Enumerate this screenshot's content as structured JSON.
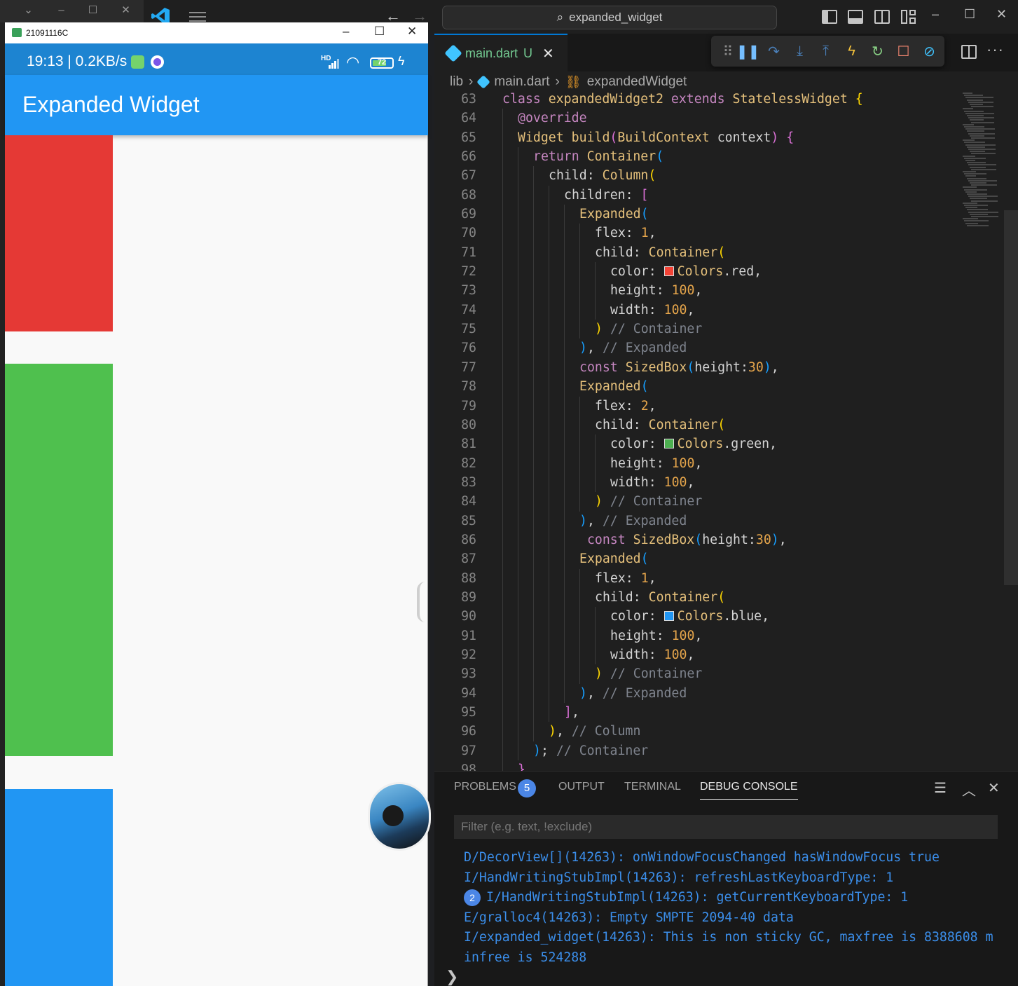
{
  "phone": {
    "window_title": "21091116C",
    "status": {
      "time": "19:13 | 0.2KB/s",
      "network": "HD",
      "battery": "72"
    },
    "app_title": "Expanded Widget",
    "boxes": [
      {
        "name": "red-box",
        "color": "#e53935"
      },
      {
        "name": "green-box",
        "color": "#4fc04e"
      },
      {
        "name": "blue-box",
        "color": "#2196f3"
      }
    ]
  },
  "vscode": {
    "command_center": "expanded_widget",
    "tab": {
      "name": "main.dart",
      "badge": "U"
    },
    "breadcrumb": {
      "root": "lib",
      "file": "main.dart",
      "symbol": "expandedWidget"
    },
    "code_lines": [
      {
        "n": "63",
        "html": "<span class=\"kw\">class</span> <span class=\"ty\">expandedWidget2</span> <span class=\"kw\">extends</span> <span class=\"ty\">StatelessWidget</span> <span class=\"br1\">{</span>",
        "indent": 0
      },
      {
        "n": "64",
        "html": "<span class=\"ann\">@override</span>",
        "indent": 1
      },
      {
        "n": "65",
        "html": "<span class=\"ty\">Widget</span> <span class=\"fn\">build</span><span class=\"br2\">(</span><span class=\"ty\">BuildContext</span> context<span class=\"br2\">)</span> <span class=\"br2\">{</span>",
        "indent": 1
      },
      {
        "n": "66",
        "html": "<span class=\"kw\">return</span> <span class=\"ty\">Container</span><span class=\"br3\">(</span>",
        "indent": 2
      },
      {
        "n": "67",
        "html": "child: <span class=\"ty\">Column</span><span class=\"br1\">(</span>",
        "indent": 3
      },
      {
        "n": "68",
        "html": "children: <span class=\"br2\">[</span>",
        "indent": 4
      },
      {
        "n": "69",
        "html": "<span class=\"ty\">Expanded</span><span class=\"br3\">(</span>",
        "indent": 5
      },
      {
        "n": "70",
        "html": "flex: <span class=\"num\">1</span>,",
        "indent": 6
      },
      {
        "n": "71",
        "html": "child: <span class=\"ty\">Container</span><span class=\"br1\">(</span>",
        "indent": 6
      },
      {
        "n": "72",
        "html": "color: <span class=\"sw\" style=\"background:#f44336\"></span><span class=\"ty\">Colors</span>.red,",
        "indent": 7
      },
      {
        "n": "73",
        "html": "height: <span class=\"num\">100</span>,",
        "indent": 7
      },
      {
        "n": "74",
        "html": "width: <span class=\"num\">100</span>,",
        "indent": 7
      },
      {
        "n": "75",
        "html": "<span class=\"br1\">)</span> <span class=\"cm\">// Container</span>",
        "indent": 6
      },
      {
        "n": "76",
        "html": "<span class=\"br3\">)</span>, <span class=\"cm\">// Expanded</span>",
        "indent": 5
      },
      {
        "n": "77",
        "html": "<span class=\"kw\">const</span> <span class=\"ty\">SizedBox</span><span class=\"br3\">(</span>height:<span class=\"num\">30</span><span class=\"br3\">)</span>,",
        "indent": 5
      },
      {
        "n": "78",
        "html": "<span class=\"ty\">Expanded</span><span class=\"br3\">(</span>",
        "indent": 5
      },
      {
        "n": "79",
        "html": "flex: <span class=\"num\">2</span>,",
        "indent": 6
      },
      {
        "n": "80",
        "html": "child: <span class=\"ty\">Container</span><span class=\"br1\">(</span>",
        "indent": 6
      },
      {
        "n": "81",
        "html": "color: <span class=\"sw\" style=\"background:#4caf50\"></span><span class=\"ty\">Colors</span>.green,",
        "indent": 7
      },
      {
        "n": "82",
        "html": "height: <span class=\"num\">100</span>,",
        "indent": 7
      },
      {
        "n": "83",
        "html": "width: <span class=\"num\">100</span>,",
        "indent": 7
      },
      {
        "n": "84",
        "html": "<span class=\"br1\">)</span> <span class=\"cm\">// Container</span>",
        "indent": 6
      },
      {
        "n": "85",
        "html": "<span class=\"br3\">)</span>, <span class=\"cm\">// Expanded</span>",
        "indent": 5
      },
      {
        "n": "86",
        "html": " <span class=\"kw\">const</span> <span class=\"ty\">SizedBox</span><span class=\"br3\">(</span>height:<span class=\"num\">30</span><span class=\"br3\">)</span>,",
        "indent": 5
      },
      {
        "n": "87",
        "html": "<span class=\"ty\">Expanded</span><span class=\"br3\">(</span>",
        "indent": 5
      },
      {
        "n": "88",
        "html": "flex: <span class=\"num\">1</span>,",
        "indent": 6
      },
      {
        "n": "89",
        "html": "child: <span class=\"ty\">Container</span><span class=\"br1\">(</span>",
        "indent": 6
      },
      {
        "n": "90",
        "html": "color: <span class=\"sw\" style=\"background:#2196f3\"></span><span class=\"ty\">Colors</span>.blue,",
        "indent": 7
      },
      {
        "n": "91",
        "html": "height: <span class=\"num\">100</span>,",
        "indent": 7
      },
      {
        "n": "92",
        "html": "width: <span class=\"num\">100</span>,",
        "indent": 7
      },
      {
        "n": "93",
        "html": "<span class=\"br1\">)</span> <span class=\"cm\">// Container</span>",
        "indent": 6
      },
      {
        "n": "94",
        "html": "<span class=\"br3\">)</span>, <span class=\"cm\">// Expanded</span>",
        "indent": 5
      },
      {
        "n": "95",
        "html": "<span class=\"br2\">]</span>,",
        "indent": 4
      },
      {
        "n": "96",
        "html": "<span class=\"br1\">)</span>, <span class=\"cm\">// Column</span>",
        "indent": 3
      },
      {
        "n": "97",
        "html": "<span class=\"br3\">)</span>; <span class=\"cm\">// Container</span>",
        "indent": 2
      },
      {
        "n": "98",
        "html": "<span class=\"br2\">}</span>",
        "indent": 1
      }
    ],
    "panel": {
      "tabs": [
        "PROBLEMS",
        "OUTPUT",
        "TERMINAL",
        "DEBUG CONSOLE"
      ],
      "problems_count": "5",
      "filter_placeholder": "Filter (e.g. text, !exclude)",
      "console_lines": [
        {
          "text": "D/DecorView[](14263): onWindowFocusChanged hasWindowFocus true"
        },
        {
          "text": "I/HandWritingStubImpl(14263): refreshLastKeyboardType: 1"
        },
        {
          "text": "I/HandWritingStubImpl(14263): getCurrentKeyboardType: 1",
          "repeat": "2"
        },
        {
          "text": "E/gralloc4(14263): Empty SMPTE 2094-40 data"
        },
        {
          "text": "I/expanded_widget(14263): This is non sticky GC, maxfree is 8388608 m"
        },
        {
          "text": "infree is 524288"
        }
      ],
      "prompt": "❯"
    }
  }
}
